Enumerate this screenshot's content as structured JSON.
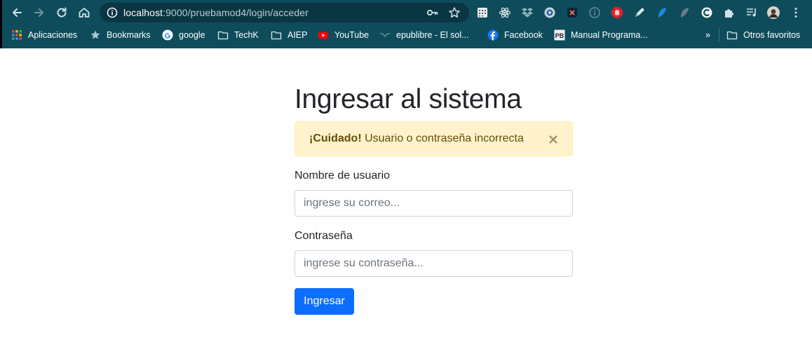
{
  "browser": {
    "url_host": "localhost",
    "url_rest": ":9000/pruebamod4/login/acceder",
    "bookmarks": [
      {
        "label": "Aplicaciones",
        "icon": "apps-grid-icon"
      },
      {
        "label": "Bookmarks",
        "icon": "star-icon"
      },
      {
        "label": "google",
        "icon": "google-icon"
      },
      {
        "label": "TechK",
        "icon": "folder-icon"
      },
      {
        "label": "AIEP",
        "icon": "folder-icon"
      },
      {
        "label": "YouTube",
        "icon": "youtube-icon"
      },
      {
        "label": "epublibre - El sol...",
        "icon": "epublibre-icon"
      },
      {
        "label": "Facebook",
        "icon": "facebook-icon"
      },
      {
        "label": "Manual Programa...",
        "icon": "pb-icon"
      }
    ],
    "overflow_label": "»",
    "other_bookmarks": "Otros favoritos",
    "colors": {
      "chrome": "#0e4c5c",
      "omnibox": "#0a3542"
    }
  },
  "page": {
    "title": "Ingresar al sistema",
    "alert": {
      "strong": "¡Cuidado!",
      "message": " Usuario o contraseña incorrecta",
      "colors": {
        "bg": "#fff3cd",
        "text": "#664d03"
      }
    },
    "username": {
      "label": "Nombre de usuario",
      "placeholder": "ingrese su correo..."
    },
    "password": {
      "label": "Contraseña",
      "placeholder": "ingrese su contraseña..."
    },
    "submit_label": "Ingresar",
    "colors": {
      "primary": "#0d6efd"
    }
  }
}
